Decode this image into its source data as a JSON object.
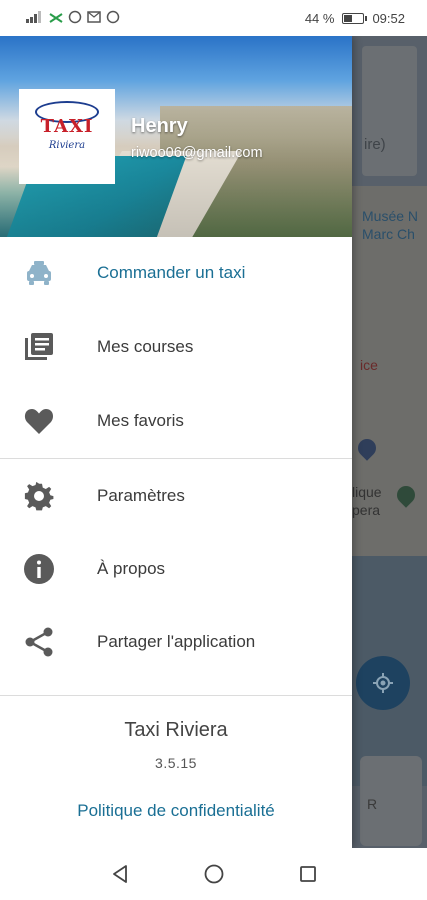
{
  "status_bar": {
    "left_icons": [
      "signal-icon",
      "wifi-off-icon",
      "whatsapp-icon",
      "mail-icon",
      "whatsapp-icon"
    ],
    "battery": "44 %",
    "time": "09:52"
  },
  "drawer": {
    "header": {
      "logo_text": "TAXI",
      "logo_subtext": "Riviera",
      "user_name": "Henry",
      "user_email": "riwoo06@gmail.com"
    },
    "menu_primary": [
      {
        "label": "Commander un taxi",
        "icon": "taxi-icon",
        "active": true
      },
      {
        "label": "Mes courses",
        "icon": "list-icon",
        "active": false
      },
      {
        "label": "Mes favoris",
        "icon": "heart-icon",
        "active": false
      }
    ],
    "menu_secondary": [
      {
        "label": "Paramètres",
        "icon": "gear-icon"
      },
      {
        "label": "À propos",
        "icon": "info-icon"
      },
      {
        "label": "Partager l'application",
        "icon": "share-icon"
      }
    ],
    "footer": {
      "app_name": "Taxi Riviera",
      "version": "3.5.15",
      "privacy_link": "Politique de confidentialité"
    }
  },
  "map_background": {
    "card_text": "ire)",
    "labels": [
      "Musée N",
      "Marc Ch",
      "ice",
      "lique",
      "pera"
    ],
    "bottom_card_text": "R"
  },
  "colors": {
    "accent": "#1a6f94",
    "active_icon": "#8fb3c9",
    "icon_gray": "#5a5a5a"
  }
}
